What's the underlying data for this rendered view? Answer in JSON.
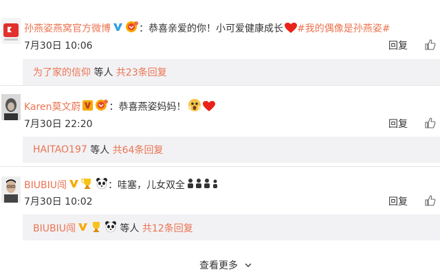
{
  "comments": [
    {
      "username": "孙燕姿燕窝官方微博",
      "text": "：恭喜亲爱的你！小可爱健康成长",
      "topic": "#我的偶像是孙燕姿#",
      "time": "7月30日 10:06",
      "reply_label": "回复",
      "subreply": {
        "user": "为了家的信仰",
        "middle": " 等人 ",
        "count": "共23条回复"
      }
    },
    {
      "username": "Karen莫文蔚",
      "text": "：恭喜燕姿妈妈！",
      "time": "7月30日 22:20",
      "reply_label": "回复",
      "subreply": {
        "user": "HAITAO197",
        "middle": " 等人 ",
        "count": "共64条回复"
      }
    },
    {
      "username": "BIUBIU闯",
      "text": "：哇塞，儿女双全",
      "time": "7月30日 10:02",
      "reply_label": "回复",
      "subreply": {
        "user": "BIUBIU闯",
        "middle": " 等人 ",
        "count": "共12条回复"
      }
    }
  ],
  "more_label": "查看更多",
  "colors": {
    "accent": "#eb7350",
    "text": "#333333",
    "subbox": "#f2f2f5",
    "vip": "#f7a800",
    "verified": "#2ea0e6"
  },
  "icons": [
    "blue-v-icon",
    "orange-v-icon",
    "vip-badge-icon",
    "trophy-badge-icon",
    "panda-icon",
    "heart-icon",
    "scared-emoji-icon",
    "thumbs-up-icon",
    "chevron-down-icon"
  ]
}
